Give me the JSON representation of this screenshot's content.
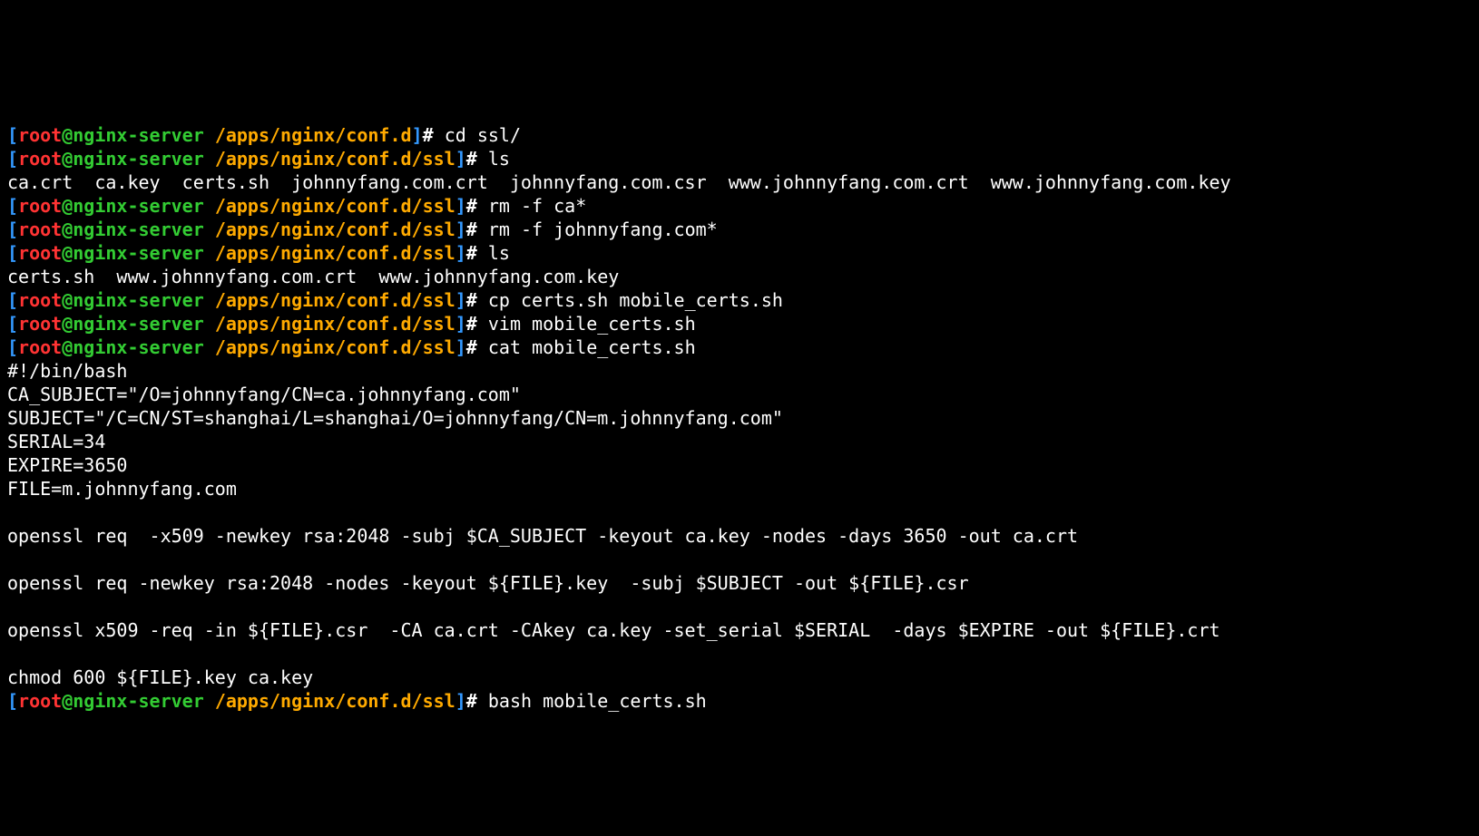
{
  "prompt": {
    "open": "[",
    "user": "root",
    "at": "@",
    "host": "nginx-server ",
    "close": "]",
    "hash": "# "
  },
  "paths": {
    "confd": "/apps/nginx/conf.d",
    "ssl": "/apps/nginx/conf.d/ssl"
  },
  "lines": [
    {
      "path": "confd",
      "cmd": "cd ssl/"
    },
    {
      "path": "ssl",
      "cmd": "ls"
    },
    {
      "out": "ca.crt  ca.key  certs.sh  johnnyfang.com.crt  johnnyfang.com.csr  www.johnnyfang.com.crt  www.johnnyfang.com.key"
    },
    {
      "path": "ssl",
      "cmd": "rm -f ca*"
    },
    {
      "path": "ssl",
      "cmd": "rm -f johnnyfang.com*"
    },
    {
      "path": "ssl",
      "cmd": "ls"
    },
    {
      "out": "certs.sh  www.johnnyfang.com.crt  www.johnnyfang.com.key"
    },
    {
      "path": "ssl",
      "cmd": "cp certs.sh mobile_certs.sh"
    },
    {
      "path": "ssl",
      "cmd": "vim mobile_certs.sh"
    },
    {
      "path": "ssl",
      "cmd": "cat mobile_certs.sh"
    },
    {
      "out": "#!/bin/bash"
    },
    {
      "out": "CA_SUBJECT=\"/O=johnnyfang/CN=ca.johnnyfang.com\""
    },
    {
      "out": "SUBJECT=\"/C=CN/ST=shanghai/L=shanghai/O=johnnyfang/CN=m.johnnyfang.com\""
    },
    {
      "out": "SERIAL=34"
    },
    {
      "out": "EXPIRE=3650"
    },
    {
      "out": "FILE=m.johnnyfang.com"
    },
    {
      "out": ""
    },
    {
      "out": "openssl req  -x509 -newkey rsa:2048 -subj $CA_SUBJECT -keyout ca.key -nodes -days 3650 -out ca.crt"
    },
    {
      "out": ""
    },
    {
      "out": "openssl req -newkey rsa:2048 -nodes -keyout ${FILE}.key  -subj $SUBJECT -out ${FILE}.csr"
    },
    {
      "out": ""
    },
    {
      "out": "openssl x509 -req -in ${FILE}.csr  -CA ca.crt -CAkey ca.key -set_serial $SERIAL  -days $EXPIRE -out ${FILE}.crt"
    },
    {
      "out": ""
    },
    {
      "out": "chmod 600 ${FILE}.key ca.key"
    },
    {
      "path": "ssl",
      "cmd": "bash mobile_certs.sh"
    }
  ]
}
